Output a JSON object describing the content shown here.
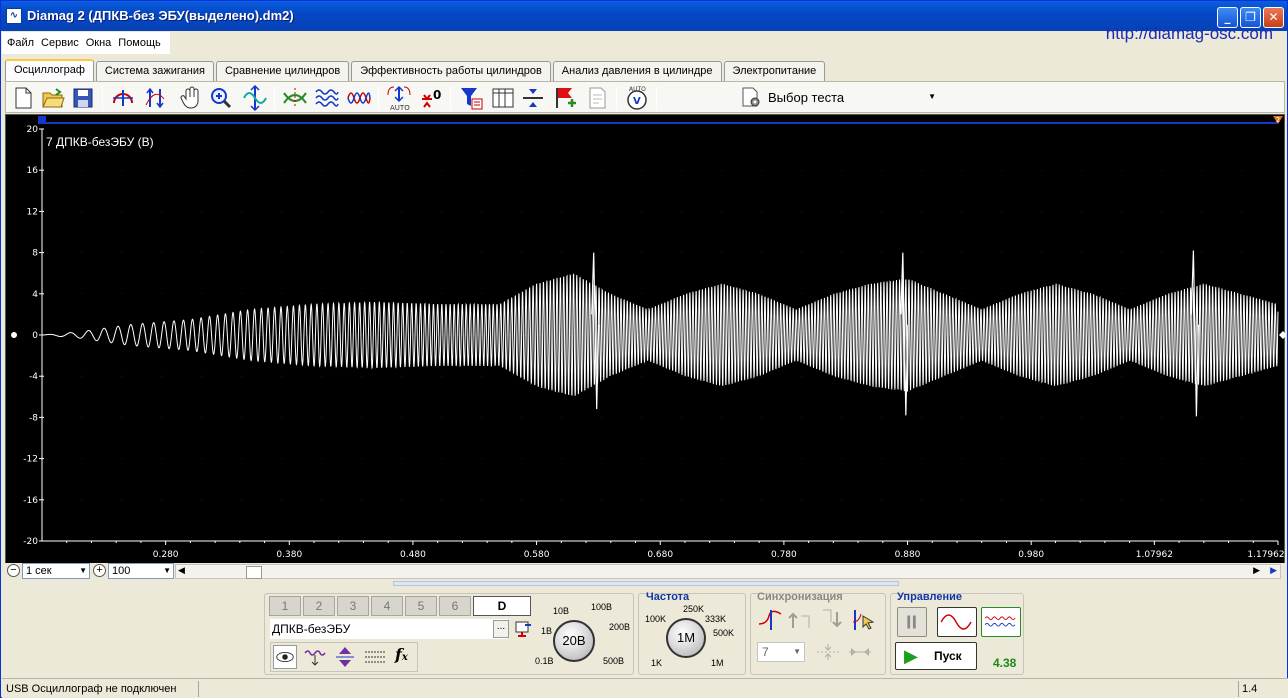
{
  "window": {
    "title": "Diamag 2 (ДПКВ-без ЭБУ(выделено).dm2)",
    "app_icon": "oscilloscope-icon",
    "url": "http://diamag-osc.com"
  },
  "menu": [
    "Файл",
    "Сервис",
    "Окна",
    "Помощь"
  ],
  "tabs": [
    "Осциллограф",
    "Система зажигания",
    "Сравнение цилиндров",
    "Эффективность работы цилиндров",
    "Анализ давления в цилиндре",
    "Электропитание"
  ],
  "toolbar": {
    "test_select": "Выбор теста",
    "auto_label": "AUTO",
    "zero_label": "0"
  },
  "scope": {
    "channel_title": "7 ДПКВ-безЭБУ (В)",
    "marker_left": "1",
    "marker_right": "2"
  },
  "chart_data": {
    "type": "line",
    "title": "7 ДПКВ-безЭБУ (В)",
    "ylim": [
      -20,
      20
    ],
    "yticks": [
      "20",
      "16",
      "12",
      "8",
      "4",
      "0",
      "-4",
      "-8",
      "-12",
      "-16",
      "-20"
    ],
    "xlim": [
      0.18,
      1.17962
    ],
    "xticks": [
      "0.280",
      "0.380",
      "0.480",
      "0.580",
      "0.680",
      "0.780",
      "0.880",
      "0.980",
      "1.07962",
      "1.17962"
    ],
    "series": [
      {
        "description": "crank sensor sinusoidal signal with growing amplitude",
        "envelope_points": [
          [
            0.18,
            0
          ],
          [
            0.21,
            0.3
          ],
          [
            0.25,
            1
          ],
          [
            0.3,
            1.5
          ],
          [
            0.35,
            2.5
          ],
          [
            0.4,
            3.0
          ],
          [
            0.45,
            3.2
          ],
          [
            0.5,
            3.0
          ],
          [
            0.55,
            3.0
          ],
          [
            0.58,
            5.0
          ],
          [
            0.61,
            6.0
          ],
          [
            0.64,
            4.0
          ],
          [
            0.67,
            2.5
          ],
          [
            0.7,
            4.0
          ],
          [
            0.73,
            5.0
          ],
          [
            0.76,
            4.0
          ],
          [
            0.79,
            2.5
          ],
          [
            0.82,
            4.0
          ],
          [
            0.85,
            5.0
          ],
          [
            0.88,
            5.5
          ],
          [
            0.91,
            4.0
          ],
          [
            0.94,
            2.5
          ],
          [
            0.97,
            4.0
          ],
          [
            1.0,
            5.0
          ],
          [
            1.03,
            4.0
          ],
          [
            1.06,
            2.5
          ],
          [
            1.09,
            4.0
          ],
          [
            1.12,
            5.0
          ],
          [
            1.15,
            4.0
          ],
          [
            1.17962,
            3.0
          ]
        ],
        "spikes": [
          {
            "x": 0.627,
            "high": 8.0,
            "low": -7.2
          },
          {
            "x": 0.877,
            "high": 8.0,
            "low": -7.8
          },
          {
            "x": 1.112,
            "high": 8.2,
            "low": -7.9
          }
        ]
      }
    ]
  },
  "timebar": {
    "time_value": "1 сек",
    "points_value": "100"
  },
  "channel_panel": {
    "buttons": [
      "1",
      "2",
      "3",
      "4",
      "5",
      "6",
      "D"
    ],
    "channel_name": "ДПКВ-безЭБУ",
    "browse": "..."
  },
  "voltage": {
    "value": "20В",
    "labels": [
      "10В",
      "100В",
      "200В",
      "500В",
      "0.1В",
      "1В"
    ]
  },
  "frequency": {
    "title": "Частота",
    "value": "1M",
    "labels": [
      "250K",
      "333K",
      "500K",
      "1M",
      "100K",
      "1K"
    ]
  },
  "sync": {
    "title": "Синхронизация",
    "channel": "7"
  },
  "control": {
    "title": "Управление",
    "start": "Пуск",
    "value": "4.38"
  },
  "status": {
    "left": "USB Осциллограф не подключен",
    "right": "1.4"
  }
}
